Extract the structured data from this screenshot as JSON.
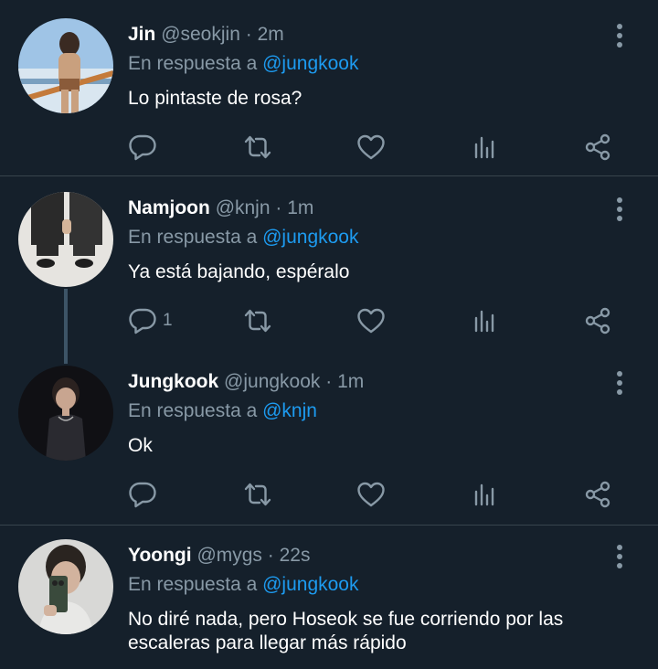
{
  "tweets": [
    {
      "name": "Jin",
      "handle": "@seokjin",
      "time": "2m",
      "reply_prefix": "En respuesta a",
      "reply_to": "@jungkook",
      "text": "Lo pintaste de rosa?",
      "reply_count": ""
    },
    {
      "name": "Namjoon",
      "handle": "@knjn",
      "time": "1m",
      "reply_prefix": "En respuesta a",
      "reply_to": "@jungkook",
      "text": "Ya está bajando, espéralo",
      "reply_count": "1"
    },
    {
      "name": "Jungkook",
      "handle": "@jungkook",
      "time": "1m",
      "reply_prefix": "En respuesta a",
      "reply_to": "@knjn",
      "text": "Ok",
      "reply_count": ""
    },
    {
      "name": "Yoongi",
      "handle": "@mygs",
      "time": "22s",
      "reply_prefix": "En respuesta a",
      "reply_to": "@jungkook",
      "text": "No diré nada, pero Hoseok se fue corriendo por las escaleras para llegar más rápido",
      "reply_count": ""
    }
  ],
  "separator": "·",
  "colors": {
    "background": "#15202b",
    "divider": "#38444d",
    "muted": "#8899a6",
    "link": "#1d9bf0",
    "icon": "#8899a6"
  },
  "icons": {
    "reply": "reply-icon",
    "retweet": "retweet-icon",
    "like": "heart-icon",
    "stats": "stats-icon",
    "share": "share-icon",
    "more": "more-vertical-icon"
  }
}
